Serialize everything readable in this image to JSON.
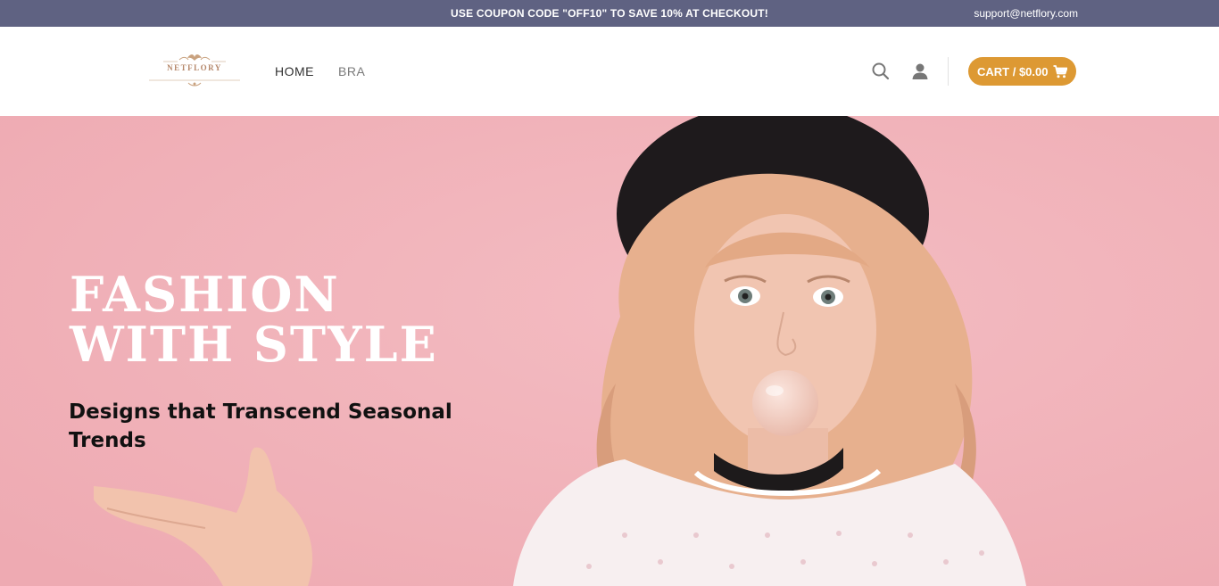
{
  "topbar": {
    "promo": "USE COUPON CODE \"OFF10\" TO SAVE 10% AT CHECKOUT!",
    "email": "support@netflory.com",
    "background": "#5f6282"
  },
  "header": {
    "logo_text": "NETFLORY",
    "nav": [
      {
        "label": "HOME",
        "active": true
      },
      {
        "label": "BRA",
        "active": false
      }
    ],
    "search_icon": "search-icon",
    "account_icon": "user-icon",
    "cart": {
      "label": "CART / $0.00",
      "icon": "cart-icon",
      "color": "#dd9933"
    }
  },
  "hero": {
    "title_line1": "FASHION",
    "title_line2": "WITH STYLE",
    "subtitle": "Designs that Transcend Seasonal Trends",
    "background": "#f1b2b8"
  }
}
